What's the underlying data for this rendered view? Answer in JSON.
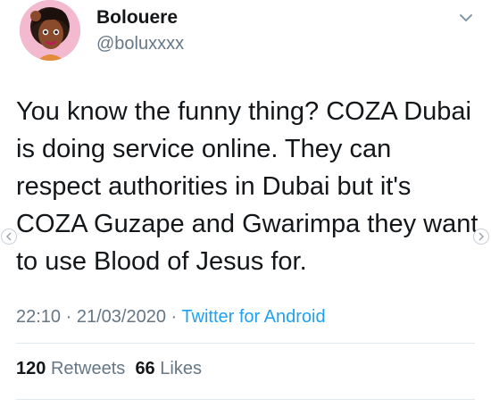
{
  "author": {
    "display_name": "Bolouere",
    "handle": "@boluxxxx",
    "avatar_icon": "avatar-cartoon-woman"
  },
  "tweet": {
    "text": "You know the funny thing? COZA Dubai is doing service online. They can respect authorities in Dubai but it's COZA Guzape and Gwarimpa they want to use Blood of Jesus for.",
    "time": "22:10",
    "date": "21/03/2020",
    "separator": "·",
    "source": "Twitter for Android"
  },
  "stats": {
    "retweets_count": "120",
    "retweets_label": "Retweets",
    "likes_count": "66",
    "likes_label": "Likes"
  },
  "icons": {
    "menu": "chevron-down-icon",
    "prev": "chevron-left-icon",
    "next": "chevron-right-icon"
  },
  "colors": {
    "text": "#14171a",
    "secondary": "#657786",
    "link": "#1da1f2",
    "divider": "#e1e8ed"
  }
}
